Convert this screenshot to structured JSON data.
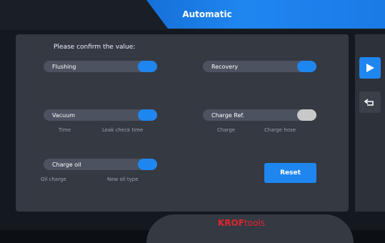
{
  "header": {
    "title": "Automatic"
  },
  "prompt": "Please confirm the value:",
  "options": {
    "flushing": {
      "label": "Flushing",
      "state": "on"
    },
    "recovery": {
      "label": "Recovery",
      "state": "on"
    },
    "vacuum": {
      "label": "Vacuum",
      "state": "on",
      "sub1": "Time",
      "sub2": "Leak check time"
    },
    "charge_ref": {
      "label": "Charge Ref.",
      "state": "off",
      "sub1": "Charge",
      "sub2": "Charge hose"
    },
    "charge_oil": {
      "label": "Charge oil",
      "state": "on",
      "sub1": "Oil charge",
      "sub2": "New oil type"
    }
  },
  "reset_label": "Reset",
  "sidebar": {
    "icons": [
      "play-icon",
      "return-icon"
    ]
  },
  "brand": {
    "part1": "KROF",
    "part2": "tools"
  },
  "colors": {
    "accent": "#1f86f0",
    "panel": "#353942",
    "brand": "#e0262e"
  }
}
